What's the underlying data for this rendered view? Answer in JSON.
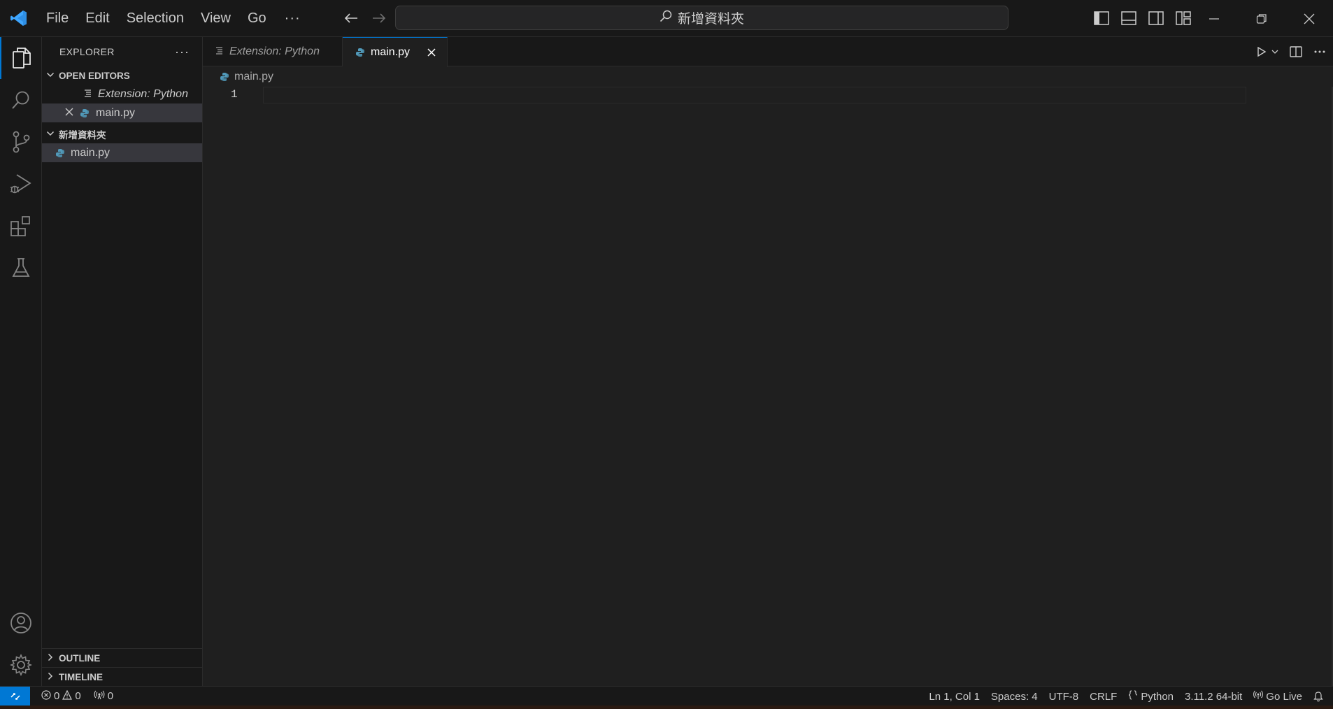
{
  "titlebar": {
    "menu": [
      "File",
      "Edit",
      "Selection",
      "View",
      "Go"
    ],
    "more": "···",
    "command_center": "新增資料夾"
  },
  "sidebar": {
    "title": "EXPLORER",
    "more": "···",
    "open_editors": {
      "header": "OPEN EDITORS",
      "items": [
        {
          "label": "Extension: Python"
        },
        {
          "label": "main.py"
        }
      ]
    },
    "folder": {
      "header": "新增資料夾",
      "items": [
        {
          "label": "main.py"
        }
      ]
    },
    "outline": "OUTLINE",
    "timeline": "TIMELINE"
  },
  "tabs": [
    {
      "label": "Extension: Python"
    },
    {
      "label": "main.py"
    }
  ],
  "breadcrumb": {
    "file": "main.py"
  },
  "editor": {
    "line_number": "1"
  },
  "statusbar": {
    "errors": "0",
    "warnings": "0",
    "ports": "0",
    "position": "Ln 1, Col 1",
    "spaces": "Spaces: 4",
    "encoding": "UTF-8",
    "eol": "CRLF",
    "language": "Python",
    "interpreter": "3.11.2 64-bit",
    "go_live": "Go Live"
  },
  "colors": {
    "accent": "#0078d4",
    "python_blue": "#519aba",
    "vscode_blue": "#2f8fe5"
  }
}
